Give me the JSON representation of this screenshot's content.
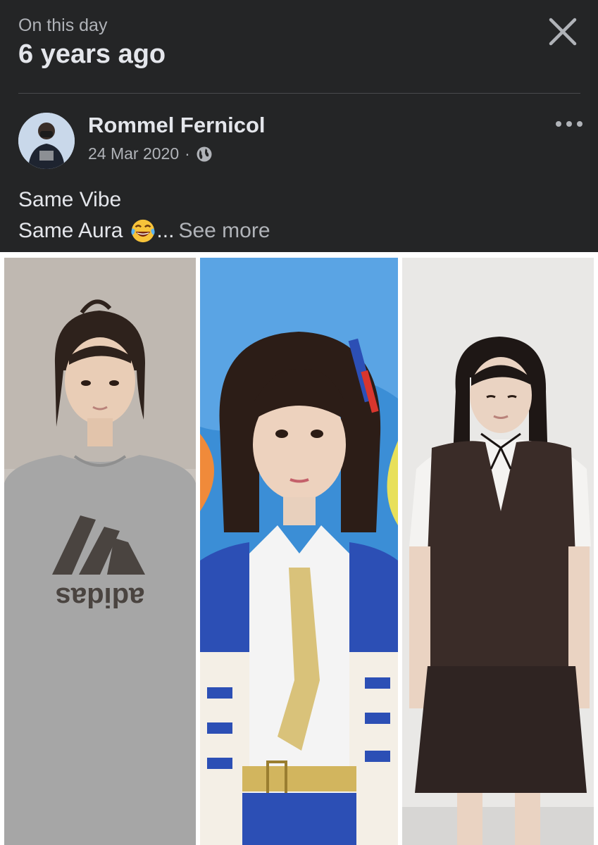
{
  "memory": {
    "kicker": "On this day",
    "title": "6 years ago"
  },
  "post": {
    "author": "Rommel Fernicol",
    "date": "24 Mar 2020",
    "separator": "·",
    "privacy_icon": "globe-icon",
    "caption_line1": "Same Vibe",
    "caption_line2": "Same Aura",
    "caption_emoji": "tears-of-joy-emoji",
    "ellipsis": "...",
    "see_more": "See more"
  },
  "photo": {
    "panels": [
      {
        "name": "girl-in-grey-tshirt",
        "shirt_text": "adidas"
      },
      {
        "name": "girl-in-idol-costume"
      },
      {
        "name": "girl-in-school-uniform"
      }
    ]
  },
  "colors": {
    "background": "#242526",
    "primary_text": "#e4e6eb",
    "secondary_text": "#b0b3b8"
  }
}
